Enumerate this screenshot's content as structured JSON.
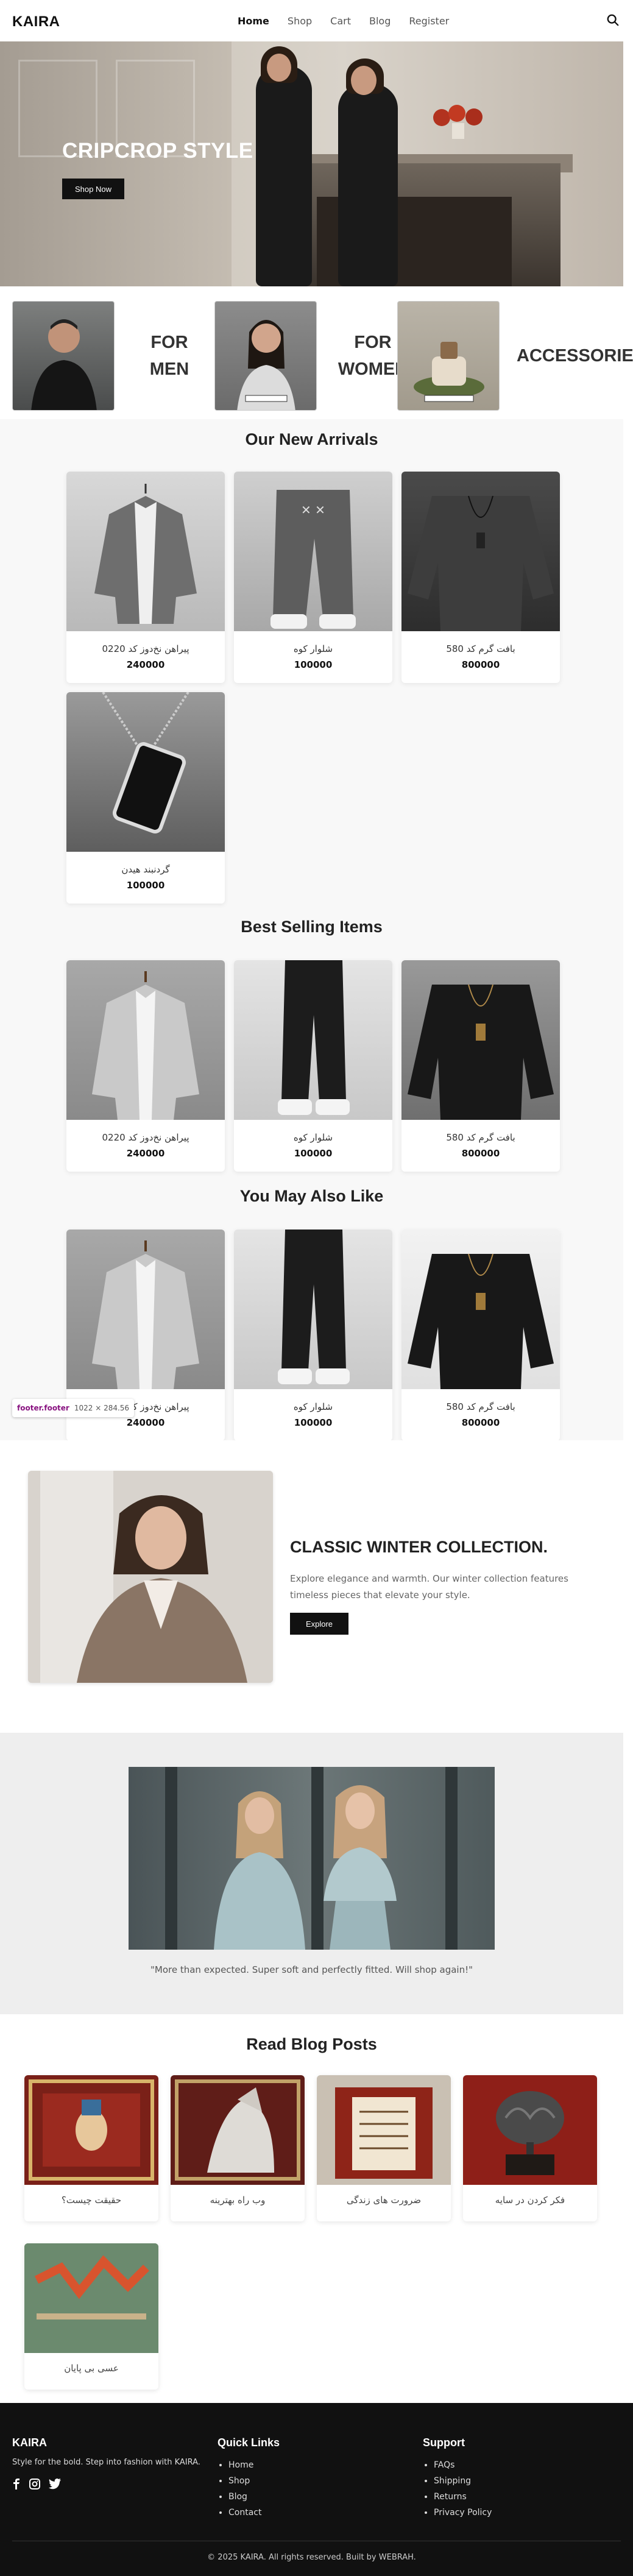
{
  "header": {
    "logo": "KAIRA",
    "nav": [
      {
        "label": "Home",
        "active": true
      },
      {
        "label": "Shop",
        "active": false
      },
      {
        "label": "Cart",
        "active": false
      },
      {
        "label": "Blog",
        "active": false
      },
      {
        "label": "Register",
        "active": false
      }
    ],
    "search_icon": "search-icon"
  },
  "hero": {
    "title": "CRIPCROP STYLE",
    "button": "Shop Now"
  },
  "categories": [
    {
      "label_line1": "FOR",
      "label_line2": "MEN"
    },
    {
      "label_line1": "FOR",
      "label_line2": "WOMEN"
    },
    {
      "label_line1": "ACCESSORIES",
      "label_line2": ""
    }
  ],
  "new_arrivals": {
    "title": "Our New Arrivals",
    "items": [
      {
        "name": "پیراهن نخ‌دوز کد 0220",
        "price": "240000"
      },
      {
        "name": "شلوار کوه",
        "price": "100000"
      },
      {
        "name": "بافت گرم کد 580",
        "price": "800000"
      },
      {
        "name": "گردنبند هیدن",
        "price": "100000"
      }
    ]
  },
  "best_selling": {
    "title": "Best Selling Items",
    "items": [
      {
        "name": "پیراهن نخ‌دوز کد 0220",
        "price": "240000"
      },
      {
        "name": "شلوار کوه",
        "price": "100000"
      },
      {
        "name": "بافت گرم کد 580",
        "price": "800000"
      }
    ]
  },
  "also_like": {
    "title": "You May Also Like",
    "items": [
      {
        "name": "پیراهن نخ‌دوز کد 0220",
        "price": "240000"
      },
      {
        "name": "شلوار کوه",
        "price": "100000"
      },
      {
        "name": "بافت گرم کد 580",
        "price": "800000"
      }
    ]
  },
  "devtools_tip": {
    "selector": "footer.footer",
    "size": "1022 × 284.56"
  },
  "winter": {
    "title": "CLASSIC WINTER COLLECTION.",
    "description": "Explore elegance and warmth. Our winter collection features timeless pieces that elevate your style.",
    "button": "Explore"
  },
  "testimonial": {
    "quote": "\"More than expected. Super soft and perfectly fitted. Will shop again!\""
  },
  "blog": {
    "title": "Read Blog Posts",
    "posts": [
      {
        "title": "حقیقت چیست؟"
      },
      {
        "title": "وب راه بهترینه"
      },
      {
        "title": "ضرورت های زندگی"
      },
      {
        "title": "فکر کردن در سایه"
      },
      {
        "title": "عسی بی پایان"
      }
    ]
  },
  "footer": {
    "brand": "KAIRA",
    "tagline": "Style for the bold. Step into fashion with KAIRA.",
    "social": [
      "facebook-icon",
      "instagram-icon",
      "twitter-icon"
    ],
    "quick_links_title": "Quick Links",
    "quick_links": [
      "Home",
      "Shop",
      "Blog",
      "Contact"
    ],
    "support_title": "Support",
    "support_links": [
      "FAQs",
      "Shipping",
      "Returns",
      "Privacy Policy"
    ],
    "copyright": "© 2025 KAIRA. All rights reserved. Built by WEBRAH."
  }
}
